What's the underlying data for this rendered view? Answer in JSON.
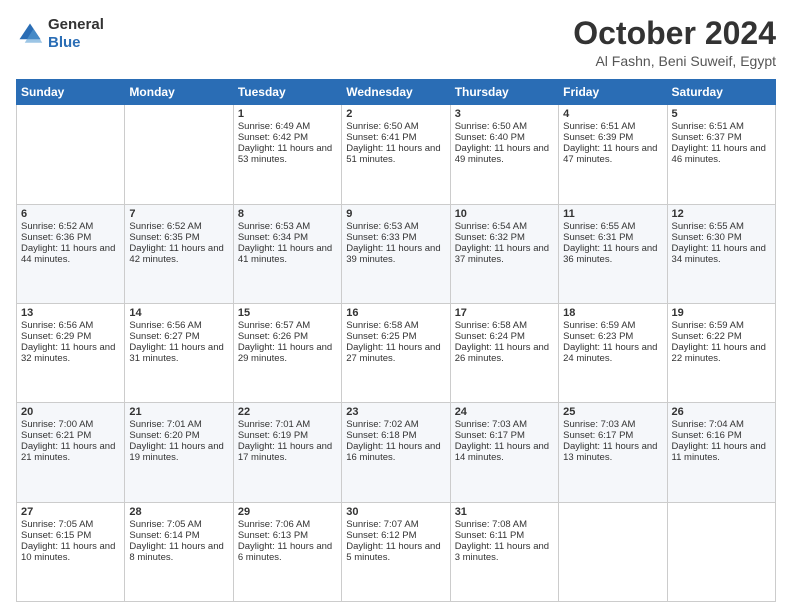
{
  "logo": {
    "general": "General",
    "blue": "Blue"
  },
  "header": {
    "title": "October 2024",
    "subtitle": "Al Fashn, Beni Suweif, Egypt"
  },
  "weekdays": [
    "Sunday",
    "Monday",
    "Tuesday",
    "Wednesday",
    "Thursday",
    "Friday",
    "Saturday"
  ],
  "weeks": [
    [
      {
        "day": "",
        "info": ""
      },
      {
        "day": "",
        "info": ""
      },
      {
        "day": "1",
        "info": "Sunrise: 6:49 AM\nSunset: 6:42 PM\nDaylight: 11 hours and 53 minutes."
      },
      {
        "day": "2",
        "info": "Sunrise: 6:50 AM\nSunset: 6:41 PM\nDaylight: 11 hours and 51 minutes."
      },
      {
        "day": "3",
        "info": "Sunrise: 6:50 AM\nSunset: 6:40 PM\nDaylight: 11 hours and 49 minutes."
      },
      {
        "day": "4",
        "info": "Sunrise: 6:51 AM\nSunset: 6:39 PM\nDaylight: 11 hours and 47 minutes."
      },
      {
        "day": "5",
        "info": "Sunrise: 6:51 AM\nSunset: 6:37 PM\nDaylight: 11 hours and 46 minutes."
      }
    ],
    [
      {
        "day": "6",
        "info": "Sunrise: 6:52 AM\nSunset: 6:36 PM\nDaylight: 11 hours and 44 minutes."
      },
      {
        "day": "7",
        "info": "Sunrise: 6:52 AM\nSunset: 6:35 PM\nDaylight: 11 hours and 42 minutes."
      },
      {
        "day": "8",
        "info": "Sunrise: 6:53 AM\nSunset: 6:34 PM\nDaylight: 11 hours and 41 minutes."
      },
      {
        "day": "9",
        "info": "Sunrise: 6:53 AM\nSunset: 6:33 PM\nDaylight: 11 hours and 39 minutes."
      },
      {
        "day": "10",
        "info": "Sunrise: 6:54 AM\nSunset: 6:32 PM\nDaylight: 11 hours and 37 minutes."
      },
      {
        "day": "11",
        "info": "Sunrise: 6:55 AM\nSunset: 6:31 PM\nDaylight: 11 hours and 36 minutes."
      },
      {
        "day": "12",
        "info": "Sunrise: 6:55 AM\nSunset: 6:30 PM\nDaylight: 11 hours and 34 minutes."
      }
    ],
    [
      {
        "day": "13",
        "info": "Sunrise: 6:56 AM\nSunset: 6:29 PM\nDaylight: 11 hours and 32 minutes."
      },
      {
        "day": "14",
        "info": "Sunrise: 6:56 AM\nSunset: 6:27 PM\nDaylight: 11 hours and 31 minutes."
      },
      {
        "day": "15",
        "info": "Sunrise: 6:57 AM\nSunset: 6:26 PM\nDaylight: 11 hours and 29 minutes."
      },
      {
        "day": "16",
        "info": "Sunrise: 6:58 AM\nSunset: 6:25 PM\nDaylight: 11 hours and 27 minutes."
      },
      {
        "day": "17",
        "info": "Sunrise: 6:58 AM\nSunset: 6:24 PM\nDaylight: 11 hours and 26 minutes."
      },
      {
        "day": "18",
        "info": "Sunrise: 6:59 AM\nSunset: 6:23 PM\nDaylight: 11 hours and 24 minutes."
      },
      {
        "day": "19",
        "info": "Sunrise: 6:59 AM\nSunset: 6:22 PM\nDaylight: 11 hours and 22 minutes."
      }
    ],
    [
      {
        "day": "20",
        "info": "Sunrise: 7:00 AM\nSunset: 6:21 PM\nDaylight: 11 hours and 21 minutes."
      },
      {
        "day": "21",
        "info": "Sunrise: 7:01 AM\nSunset: 6:20 PM\nDaylight: 11 hours and 19 minutes."
      },
      {
        "day": "22",
        "info": "Sunrise: 7:01 AM\nSunset: 6:19 PM\nDaylight: 11 hours and 17 minutes."
      },
      {
        "day": "23",
        "info": "Sunrise: 7:02 AM\nSunset: 6:18 PM\nDaylight: 11 hours and 16 minutes."
      },
      {
        "day": "24",
        "info": "Sunrise: 7:03 AM\nSunset: 6:17 PM\nDaylight: 11 hours and 14 minutes."
      },
      {
        "day": "25",
        "info": "Sunrise: 7:03 AM\nSunset: 6:17 PM\nDaylight: 11 hours and 13 minutes."
      },
      {
        "day": "26",
        "info": "Sunrise: 7:04 AM\nSunset: 6:16 PM\nDaylight: 11 hours and 11 minutes."
      }
    ],
    [
      {
        "day": "27",
        "info": "Sunrise: 7:05 AM\nSunset: 6:15 PM\nDaylight: 11 hours and 10 minutes."
      },
      {
        "day": "28",
        "info": "Sunrise: 7:05 AM\nSunset: 6:14 PM\nDaylight: 11 hours and 8 minutes."
      },
      {
        "day": "29",
        "info": "Sunrise: 7:06 AM\nSunset: 6:13 PM\nDaylight: 11 hours and 6 minutes."
      },
      {
        "day": "30",
        "info": "Sunrise: 7:07 AM\nSunset: 6:12 PM\nDaylight: 11 hours and 5 minutes."
      },
      {
        "day": "31",
        "info": "Sunrise: 7:08 AM\nSunset: 6:11 PM\nDaylight: 11 hours and 3 minutes."
      },
      {
        "day": "",
        "info": ""
      },
      {
        "day": "",
        "info": ""
      }
    ]
  ]
}
